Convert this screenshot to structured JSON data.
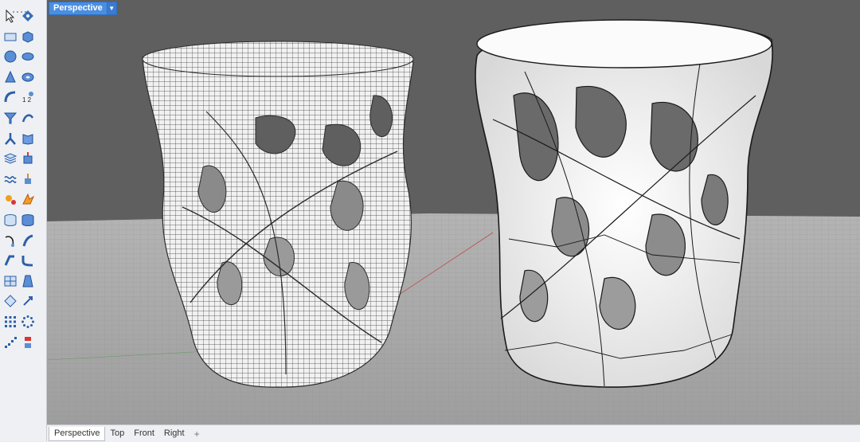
{
  "viewport": {
    "title": "Perspective",
    "menu_icon": "triangle-down-icon"
  },
  "tabs": [
    {
      "label": "Perspective",
      "active": true
    },
    {
      "label": "Top",
      "active": false
    },
    {
      "label": "Front",
      "active": false
    },
    {
      "label": "Right",
      "active": false
    }
  ],
  "add_tab_label": "+",
  "toolbar": {
    "tools": [
      "select-arrow-icon",
      "point-icon",
      "rectangle-icon",
      "box-icon",
      "sphere-icon",
      "ellipsoid-icon",
      "cone-icon",
      "torus-icon",
      "pipe-arc-icon",
      "number-points-icon",
      "funnel-icon",
      "rotate-surface-icon",
      "split-icon",
      "book-icon",
      "stack-icon",
      "extrude-icon",
      "wave-icon",
      "move-icon",
      "gear-explode-icon",
      "flare-icon",
      "cylinder-split-icon",
      "cylinder-icon",
      "curve-icon",
      "bend-icon",
      "pipe-icon",
      "fillet-icon",
      "panel-icon",
      "taper-icon",
      "array-icon",
      "rotate-blue-icon",
      "grid-dots-icon",
      "circle-dots-icon",
      "stairs-icon",
      "record-icon"
    ]
  },
  "colors": {
    "accent": "#4a8ee0",
    "viewport_bg": "#5f5f5f",
    "ground": "#a9a9a9",
    "wireframe": "#333333",
    "solid": "#f4f4f4"
  }
}
